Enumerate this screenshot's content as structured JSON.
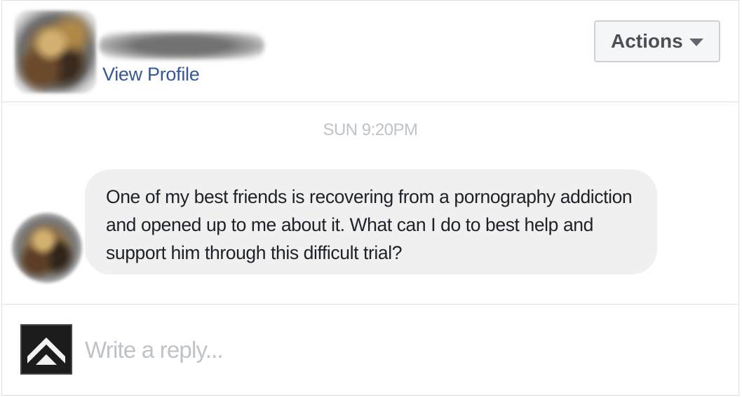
{
  "header": {
    "view_profile_label": "View Profile",
    "actions_label": "Actions",
    "actions_icon": "caret-down-icon"
  },
  "thread": {
    "timestamp": "SUN 9:20PM",
    "messages": [
      {
        "text": "One of my best friends is recovering from a pornography addiction and opened up to me about it. What can I do to best help and support him through this difficult trial?"
      }
    ]
  },
  "reply": {
    "placeholder": "Write a reply...",
    "value": "",
    "page_icon": "chevron-logo-icon"
  },
  "colors": {
    "link": "#365899",
    "bubble_bg": "#f1f0f0",
    "timestamp": "#bec3c9",
    "border": "#dddfe2",
    "text": "#1d2129"
  }
}
